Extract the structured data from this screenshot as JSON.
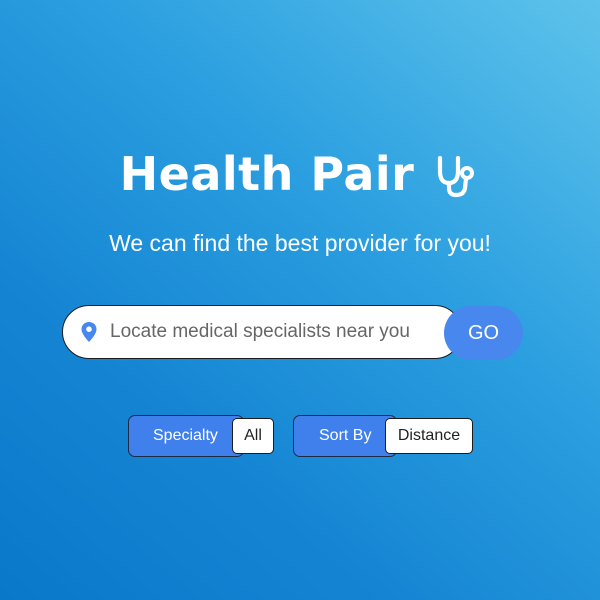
{
  "header": {
    "title": "Health Pair",
    "icon": "stethoscope-icon"
  },
  "tagline": "We can find the best provider for you!",
  "search": {
    "icon": "location-pin-icon",
    "placeholder": "Locate medical specialists near you",
    "value": "",
    "go_label": "GO"
  },
  "filters": {
    "specialty": {
      "label": "Specialty",
      "value": "All"
    },
    "sort_by": {
      "label": "Sort By",
      "value": "Distance"
    }
  },
  "colors": {
    "background_top": "#5ec3eb",
    "background_bottom": "#0a78c9",
    "accent": "#4787ee",
    "text_on_bg": "#ffffff"
  }
}
